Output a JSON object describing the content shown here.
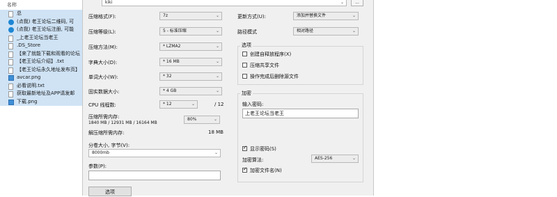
{
  "explorer": {
    "column_header": "名称",
    "files": [
      {
        "name": "总",
        "icon": "folder-doc-icon"
      },
      {
        "name": "(点我) 老王论坛二维码, 可",
        "icon": "edge-icon"
      },
      {
        "name": "(点我) 老王论坛注册, 可能",
        "icon": "edge-icon"
      },
      {
        "name": "_上老王论坛当老王",
        "icon": "doc-icon"
      },
      {
        "name": ".DS_Store",
        "icon": "doc-icon"
      },
      {
        "name": "【来了就能下载和观看的论坛",
        "icon": "doc-icon"
      },
      {
        "name": "【老王论坛介绍】.txt",
        "icon": "doc-icon"
      },
      {
        "name": "【老王论坛永久地址发布页】",
        "icon": "doc-icon"
      },
      {
        "name": "avcar.png",
        "icon": "png-icon"
      },
      {
        "name": "必看说明.txt",
        "icon": "doc-icon"
      },
      {
        "name": "获取最新地址及APP请发邮",
        "icon": "doc-icon"
      },
      {
        "name": "下载.png",
        "icon": "png-icon"
      }
    ]
  },
  "dialog": {
    "archive_name": "kiki",
    "browse_label": "...",
    "format_label": "压缩格式(F):",
    "format_value": "7z",
    "level_label": "压缩等级(L):",
    "level_value": "5 - 标准压缩",
    "method_label": "压缩方法(M):",
    "method_value": "* LZMA2",
    "dict_label": "字典大小(D):",
    "dict_value": "* 16 MB",
    "word_label": "单词大小(W):",
    "word_value": "* 32",
    "solid_label": "固实数据大小:",
    "solid_value": "* 4 GB",
    "cpu_label": "CPU 线程数:",
    "cpu_value": "* 12",
    "cpu_total": "/ 12",
    "mem_compress_label": "压缩所需内存:",
    "mem_compress_value": "1840 MB / 12931 MB / 16164 MB",
    "mem_percent": "80%",
    "mem_decompress_label": "解压缩所需内存:",
    "mem_decompress_value": "18 MB",
    "split_label": "分卷大小, 字节(V):",
    "split_value": "8000mb",
    "params_label": "参数(P):",
    "params_value": "",
    "options_button": "选项",
    "update_label": "更新方式(U):",
    "update_value": "添加并替换文件",
    "path_label": "路径模式",
    "path_value": "相对路径",
    "options_group": "选项",
    "opt_sfx": "创建自释放程序(X)",
    "opt_shared": "压缩共享文件",
    "opt_delete": "操作完成后删除源文件",
    "encrypt_group": "加密",
    "password_label": "输入密码:",
    "password_value": "上老王论坛当老王",
    "show_password": "显示密码(S)",
    "encrypt_method_label": "加密算法:",
    "encrypt_method_value": "AES-256",
    "encrypt_names": "加密文件名(N)"
  }
}
